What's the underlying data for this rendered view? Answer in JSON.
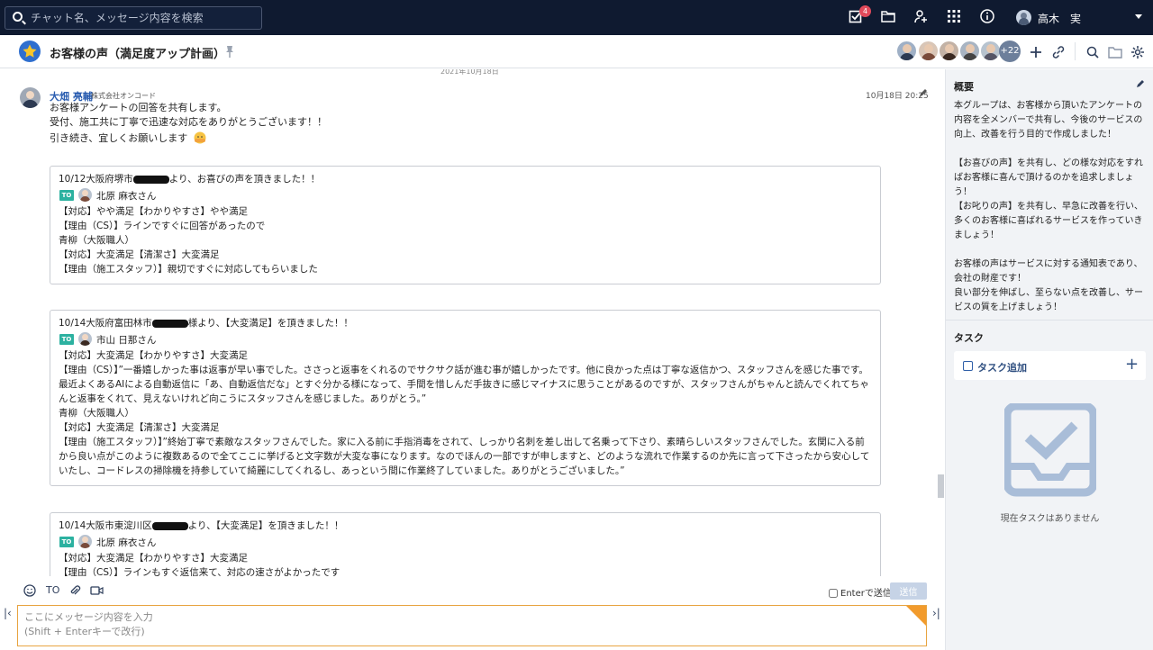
{
  "topbar": {
    "search_placeholder": "チャット名、メッセージ内容を検索",
    "task_badge": "4",
    "user_name": "高木　実"
  },
  "room": {
    "title": "お客様の声（満足度アップ計画）",
    "member_more": "+22"
  },
  "timeline": {
    "date": "2021年10月18日",
    "message": {
      "author": "大畑 亮輔",
      "org": "株式会社オンコード",
      "time": "10月18日 20:25",
      "lines": [
        "お客様アンケートの回答を共有します。",
        "受付、施工共に丁寧で迅速な対応をありがとうございます！！",
        "引き続き、宜しくお願いします"
      ]
    },
    "quotes": [
      {
        "head_pre": "10/12大阪府堺市",
        "head_post": "より、お喜びの声を頂きました！！",
        "to_label": "TO",
        "to_name": "北原 麻衣さん",
        "lines": [
          "【対応】やや満足【わかりやすさ】やや満足",
          "【理由（CS）】ラインですぐに回答があったので",
          "青柳（大阪職人）",
          "【対応】大変満足【清潔さ】大変満足",
          "【理由（施工スタッフ）】親切ですぐに対応してもらいました"
        ]
      },
      {
        "head_pre": "10/14大阪府富田林市",
        "head_post": "様より、【大変満足】を頂きました！！",
        "to_label": "TO",
        "to_name": "市山 日那さん",
        "line1": "【対応】大変満足【わかりやすさ】大変満足",
        "para1": "【理由（CS）】”一番嬉しかった事は返事が早い事でした。ささっと返事をくれるのでサクサク話が進む事が嬉しかったです。他に良かった点は丁寧な返信かつ、スタッフさんを感じた事です。最近よくあるAIによる自動返信に「あ、自動返信だな」とすぐ分かる様になって、手間を惜しんだ手抜きに感じマイナスに思うことがあるのですが、スタッフさんがちゃんと読んでくれてちゃんと返事をくれて、見えないけれど向こうにスタッフさんを感じました。ありがとう。”",
        "line2": "青柳（大阪職人）",
        "line3": "【対応】大変満足【清潔さ】大変満足",
        "para2": "【理由（施工スタッフ）】”終始丁寧で素敵なスタッフさんでした。家に入る前に手指消毒をされて、しっかり名刺を差し出して名乗って下さり、素晴らしいスタッフさんでした。玄関に入る前から良い点がこのように複数あるので全てここに挙げると文字数が大変な事になります。なのでほんの一部ですが申しますと、どのような流れで作業するのか先に言って下さったから安心していたし、コードレスの掃除機を持参していて綺麗にしてくれるし、あっという間に作業終了していました。ありがとうございました。”"
      },
      {
        "head_pre": "10/14大阪市東淀川区",
        "head_post": "より、【大変満足】を頂きました！！",
        "to_label": "TO",
        "to_name": "北原 麻衣さん",
        "lines": [
          "【対応】大変満足【わかりやすさ】大変満足",
          "【理由（CS）】ラインもすぐ返信来て、対応の速さがよかったです"
        ]
      }
    ]
  },
  "composer": {
    "to_label": "TO",
    "enter_send_label": "Enterで送信",
    "send_label": "送信",
    "placeholder": "ここにメッセージ内容を入力\n(Shift + Enterキーで改行)"
  },
  "sidebar": {
    "overview_title": "概要",
    "overview_text": "本グループは、お客様から頂いたアンケートの内容を全メンバーで共有し、今後のサービスの向上、改善を行う目的で作成しました！\n\n【お喜びの声】を共有し、どの様な対応をすればお客様に喜んで頂けるのかを追求しましょう！\n【お叱りの声】を共有し、早急に改善を行い、多くのお客様に喜ばれるサービスを作っていきましょう！\n\nお客様の声はサービスに対する通知表であり、会社の財産です！\n良い部分を伸ばし、至らない点を改善し、サービスの質を上げましょう！",
    "task_title": "タスク",
    "task_add_label": "タスク追加",
    "empty_text": "現在タスクはありません"
  },
  "colors": {
    "topbar": "#0f1a30",
    "accent": "#2f5fa8",
    "to_badge": "#2cb1a0",
    "composer_border": "#e8a441",
    "badge": "#e04a5b"
  }
}
